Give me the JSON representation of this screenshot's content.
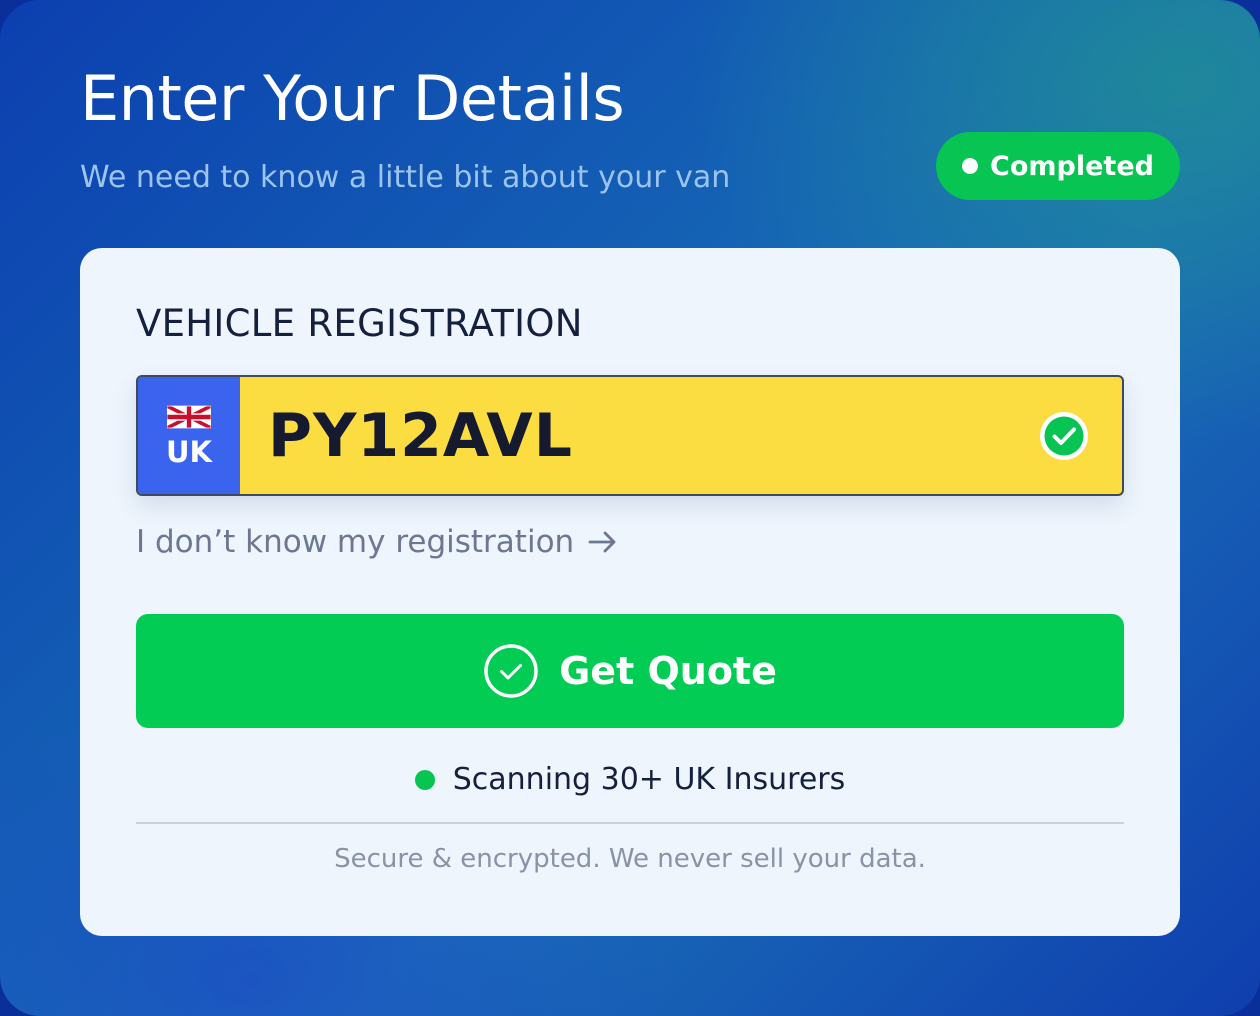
{
  "header": {
    "title": "Enter Your Details",
    "subtitle": "We need to know a little bit about your van",
    "status_label": "Completed"
  },
  "colors": {
    "accent_green": "#03cc55",
    "plate_yellow": "#fbdc41",
    "plate_band_blue": "#3a63ee",
    "ink": "#14203d"
  },
  "form": {
    "field_label": "VEHICLE REGISTRATION",
    "plate": {
      "country_code": "UK",
      "flag_icon": "union-jack-icon",
      "value": "PY12AVL",
      "valid_icon": "check-circle-icon"
    },
    "help_link": "I don’t know my registration",
    "help_link_icon": "arrow-right-icon",
    "submit_label": "Get Quote",
    "submit_icon": "check-circle-outline-icon",
    "scan_status": "Scanning 30+ UK Insurers",
    "footnote": "Secure & encrypted. We never sell your data."
  }
}
